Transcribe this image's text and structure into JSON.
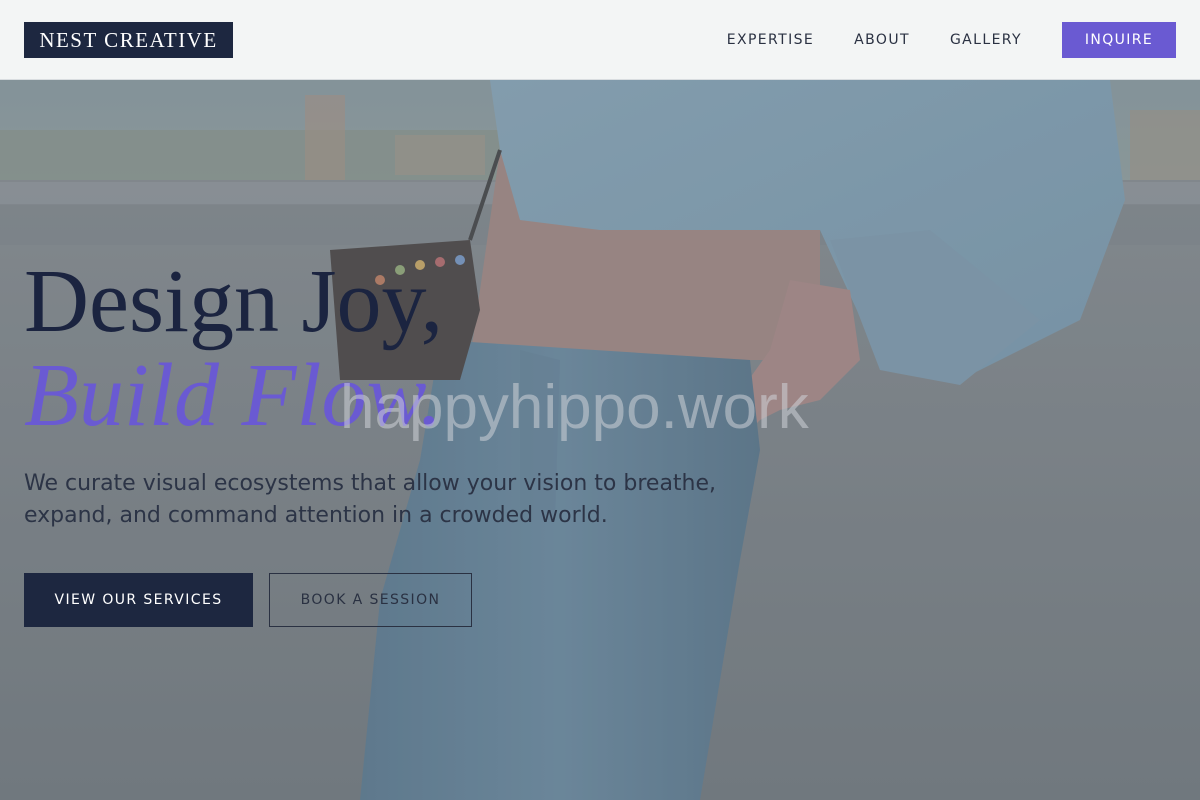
{
  "header": {
    "logo_text": "NEST CREATIVE",
    "nav": [
      {
        "label": "EXPERTISE"
      },
      {
        "label": "ABOUT"
      },
      {
        "label": "GALLERY"
      }
    ],
    "cta_label": "INQUIRE"
  },
  "hero": {
    "headline_line1": "Design Joy,",
    "headline_line2": "Build Flow.",
    "subtext": "We curate visual ecosystems that allow your vision to breathe, expand, and command attention in a crowded world.",
    "primary_button": "VIEW OUR SERVICES",
    "secondary_button": "BOOK A SESSION",
    "watermark": "happyhippo.work"
  },
  "colors": {
    "navy": "#1d2740",
    "accent_purple": "#6a5ad2",
    "header_bg": "#f8f9f9"
  }
}
